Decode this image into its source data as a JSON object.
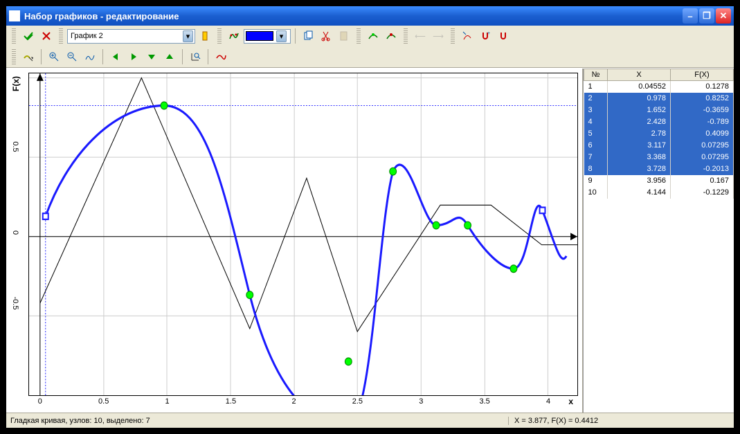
{
  "window": {
    "title": "Набор графиков - редактирование"
  },
  "toolbar": {
    "graph_selector": "График 2",
    "accept": "accept",
    "reject": "reject"
  },
  "chart_data": {
    "type": "line",
    "xlabel": "x",
    "ylabel": "F(x)",
    "xlim": [
      0,
      4.2
    ],
    "ylim": [
      -1.0,
      1.0
    ],
    "xticks": [
      0,
      0.5,
      1,
      1.5,
      2,
      2.5,
      3,
      3.5,
      4
    ],
    "yticks": [
      -0.5,
      0,
      0.5
    ],
    "series": [
      {
        "name": "polyline",
        "style": "black-thin",
        "x": [
          0,
          0.8,
          1.65,
          2.1,
          2.5,
          3.15,
          3.55,
          3.95,
          4.2
        ],
        "y": [
          -0.42,
          1.0,
          -0.58,
          0.37,
          -0.6,
          0.2,
          0.2,
          -0.05,
          -0.05
        ]
      },
      {
        "name": "smooth-curve",
        "style": "blue-thick",
        "x": [
          0.04552,
          0.978,
          1.652,
          2.428,
          2.78,
          3.117,
          3.368,
          3.728,
          3.956,
          4.144
        ],
        "y": [
          0.1278,
          0.8252,
          -0.3659,
          -0.789,
          0.4099,
          0.07295,
          0.07295,
          -0.2013,
          0.167,
          -0.1229
        ]
      }
    ],
    "guides": {
      "x": 0.04552,
      "y": 0.8252
    },
    "selected_nodes": [
      1,
      2,
      3,
      4,
      5,
      6,
      7
    ],
    "anchor_nodes": [
      0,
      9
    ]
  },
  "table": {
    "headers": {
      "n": "№",
      "x": "X",
      "fx": "F(X)"
    },
    "rows": [
      {
        "n": "1",
        "x": "0.04552",
        "fx": "0.1278",
        "selected": false
      },
      {
        "n": "2",
        "x": "0.978",
        "fx": "0.8252",
        "selected": true
      },
      {
        "n": "3",
        "x": "1.652",
        "fx": "-0.3659",
        "selected": true
      },
      {
        "n": "4",
        "x": "2.428",
        "fx": "-0.789",
        "selected": true
      },
      {
        "n": "5",
        "x": "2.78",
        "fx": "0.4099",
        "selected": true
      },
      {
        "n": "6",
        "x": "3.117",
        "fx": "0.07295",
        "selected": true
      },
      {
        "n": "7",
        "x": "3.368",
        "fx": "0.07295",
        "selected": true
      },
      {
        "n": "8",
        "x": "3.728",
        "fx": "-0.2013",
        "selected": true
      },
      {
        "n": "9",
        "x": "3.956",
        "fx": "0.167",
        "selected": false
      },
      {
        "n": "10",
        "x": "4.144",
        "fx": "-0.1229",
        "selected": false
      }
    ]
  },
  "status": {
    "left": "Гладкая кривая, узлов: 10, выделено: 7",
    "right": "X = 3.877, F(X) = 0.4412"
  },
  "ticks": {
    "x": [
      "0",
      "0.5",
      "1",
      "1.5",
      "2",
      "2.5",
      "3",
      "3.5",
      "4"
    ],
    "y": [
      "-0.5",
      "0",
      "0.5"
    ]
  }
}
